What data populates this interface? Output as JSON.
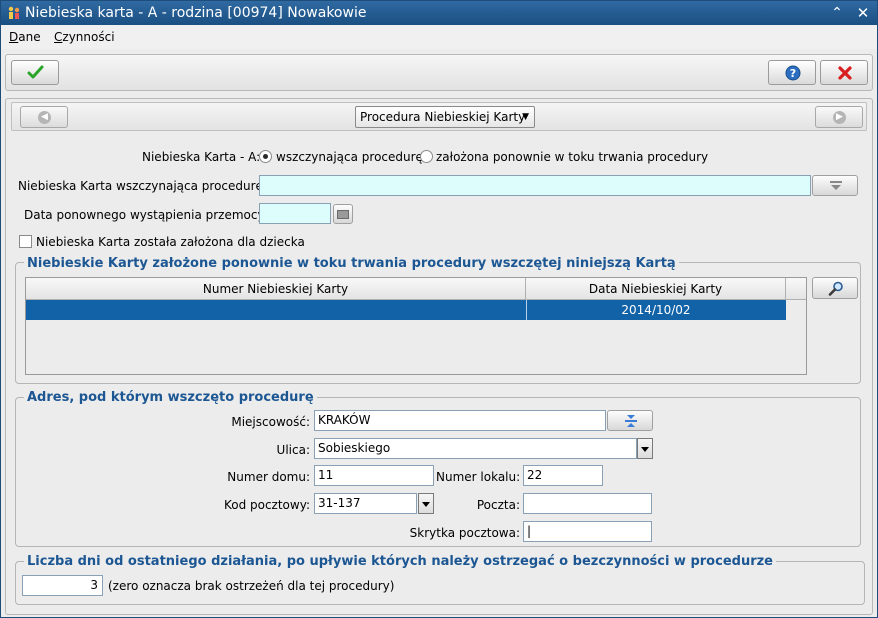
{
  "window": {
    "title": "Niebieska karta - A - rodzina [00974] Nowakowie",
    "collapse_glyph": "⌃",
    "close_glyph": "✕"
  },
  "menu": {
    "items": [
      {
        "label_first": "D",
        "label_rest": "ane"
      },
      {
        "label_first": "C",
        "label_rest": "zynności"
      }
    ]
  },
  "toolbar": {
    "ok_icon": "checkmark-icon",
    "help_icon": "help-icon",
    "cancel_icon": "x-icon"
  },
  "nav": {
    "procedure_dropdown": "Procedura Niebieskiej Karty"
  },
  "form": {
    "card_type_label": "Niebieska Karta - A:",
    "radio_initiating": "wszczynająca procedurę",
    "radio_reopened": "założona ponownie w toku trwania procedury",
    "initiating_card_label": "Niebieska Karta wszczynająca procedurę:",
    "initiating_card_value": "",
    "reoccurrence_date_label": "Data ponownego wystąpienia przemocy:",
    "reoccurrence_date_value": "",
    "child_card_label": "Niebieska Karta została założona dla dziecka"
  },
  "cards_group": {
    "title": "Niebieskie Karty założone ponownie w toku trwania procedury wszczętej niniejszą Kartą",
    "columns": [
      "Numer Niebieskiej Karty",
      "Data Niebieskiej Karty"
    ],
    "rows": [
      {
        "number": "",
        "date": "2014/10/02"
      }
    ]
  },
  "address_group": {
    "title": "Adres, pod którym wszczęto procedurę",
    "city_label": "Miejscowość:",
    "city_value": "KRAKÓW",
    "street_label": "Ulica:",
    "street_value": "Sobieskiego",
    "house_label": "Numer domu:",
    "house_value": "11",
    "apartment_label": "Numer lokalu:",
    "apartment_value": "22",
    "postal_code_label": "Kod pocztowy:",
    "postal_code_value": "31-137",
    "post_office_label": "Poczta:",
    "post_office_value": "",
    "po_box_label": "Skrytka pocztowa:",
    "po_box_value": "|"
  },
  "inactivity_group": {
    "title": "Liczba dni od ostatniego działania, po upływie których należy ostrzegać o bezczynności w procedurze",
    "days_value": "3",
    "hint": "(zero oznacza brak ostrzeżeń dla tej procedury)"
  },
  "colors": {
    "titlebar": "#1a4f82",
    "accent_blue": "#1c5793",
    "selection": "#1262a8",
    "field_cyan": "#ddfdfd"
  }
}
